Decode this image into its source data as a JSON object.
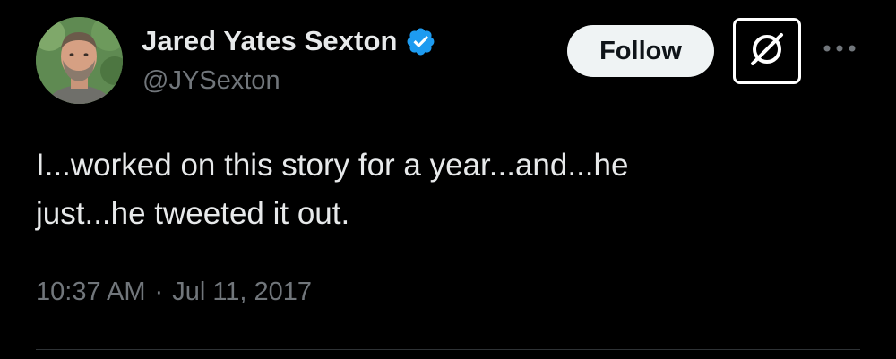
{
  "author": {
    "display_name": "Jared Yates Sexton",
    "handle": "@JYSexton",
    "verified": true,
    "verified_color": "#1d9bf0"
  },
  "actions": {
    "follow_label": "Follow",
    "grok_icon": "grok-slash-icon",
    "more_icon": "more-horizontal-icon"
  },
  "tweet": {
    "text": "I...worked on this story for a year...and...he\njust...he tweeted it out.",
    "time": "10:37 AM",
    "separator": "·",
    "date": "Jul 11, 2017"
  },
  "colors": {
    "background": "#000000",
    "primary_text": "#e7e9ea",
    "secondary_text": "#71767b",
    "follow_bg": "#eff3f4",
    "follow_text": "#0f1419",
    "divider": "#2f3336"
  }
}
